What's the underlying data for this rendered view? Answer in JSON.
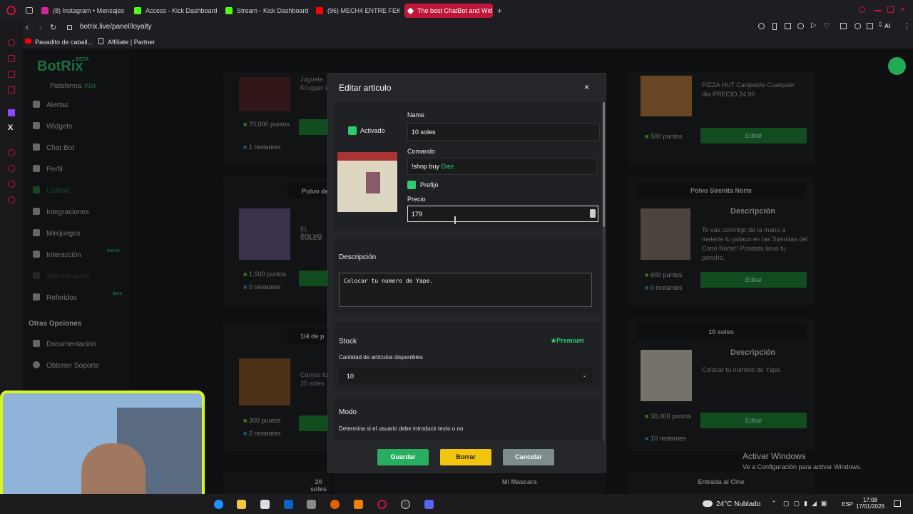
{
  "browser": {
    "tabs": [
      {
        "label": "(8) Instagram • Mensajes",
        "color": "#d6249f"
      },
      {
        "label": "Access - Kick Dashboard",
        "color": "#53fc18"
      },
      {
        "label": "Stream - Kick Dashboard",
        "color": "#53fc18"
      },
      {
        "label": "(96) MECH4 ENTRE FEKA",
        "color": "#ff0000"
      },
      {
        "label": "The best ChatBot and Wid",
        "color": "#ffffff"
      }
    ],
    "url": "botrix.live/panel/loyalty",
    "bookmarks": [
      "Pasadito de caball...",
      "Affiliate | Partner"
    ]
  },
  "sidebar": {
    "logo": "BotRix",
    "logo_badge": "BETA",
    "platform_label": "Plataforma:",
    "platform_value": "Kick",
    "items": [
      "Alertas",
      "Widgets",
      "Chat Bot",
      "Perfil",
      "Lealtad",
      "Integraciones",
      "Minijuegos",
      "Interacción",
      "Sub-Usuarios",
      "Referidos"
    ],
    "badge_nuevo": "NUEVO",
    "badge_beta": "BETA",
    "other_title": "Otras Opciones",
    "other_items": [
      "Documentación",
      "Obtener Soporte"
    ]
  },
  "cards": {
    "c1": {
      "title": "Juguete",
      "title2": "Krugger s",
      "points": "70,000 puntos",
      "stock": "1 restantes"
    },
    "c2": {
      "title": "Polvo de",
      "desc1": "EL POLVO",
      "desc2": "SOLES",
      "points": "1,500 puntos",
      "stock": "0 restantes"
    },
    "c3": {
      "title": "1/4 de p",
      "desc1": "Canjea tu",
      "desc2": "25 soles",
      "points": "300 puntos",
      "stock": "2 restantes"
    },
    "c4": {
      "desc1": "PIZZA HUT Canjeable Cualquier",
      "desc2": "día PRECIO 24.90",
      "points": "500 puntos",
      "btn": "Editar"
    },
    "c5": {
      "title": "Polvo Sirenita Norte",
      "desc_title": "Descripción",
      "desc": "Te vas conmigo de la mano a meterte tu polaco en las Sirenitas del Cono Norte!! Posdata lleva tu poncho.",
      "points": "600 puntos",
      "stock": "0 restantes",
      "btn": "Editar"
    },
    "c6": {
      "title": "10 soles",
      "desc_title": "Descripción",
      "desc": "Colocar tu numero de Yape.",
      "points": "30,000 puntos",
      "stock": "10 restantes",
      "btn": "Editar"
    },
    "bottom": [
      "20 soles",
      "Mi Mascara",
      "Entrada al Cine"
    ]
  },
  "modal": {
    "title": "Editar articulo",
    "close": "×",
    "activado": "Activado",
    "name_label": "Name",
    "name_value": "10 soles",
    "comando_label": "Comando",
    "comando_prefix": "!shop buy",
    "comando_value": "Diez",
    "prefijo": "Prefijo",
    "precio_label": "Precio",
    "precio_value": "179",
    "descripcion_label": "Descripción",
    "descripcion_value": "Colocar tu numero de Yape.",
    "stock_label": "Stock",
    "premium": "Premium",
    "stock_hint": "Cantidad de artículos disponibles",
    "stock_value": "10",
    "modo_label": "Modo",
    "modo_hint": "Determina si el usuario debe introducir texto o no",
    "save": "Guardar",
    "delete": "Borrar",
    "cancel": "Cancelar"
  },
  "watermark": {
    "line1": "Activar Windows",
    "line2": "Ve a Configuración para activar Windows."
  },
  "taskbar": {
    "weather": "24°C Nublado",
    "lang": "ESP",
    "time": "17:08",
    "date": "17/01/2026"
  }
}
